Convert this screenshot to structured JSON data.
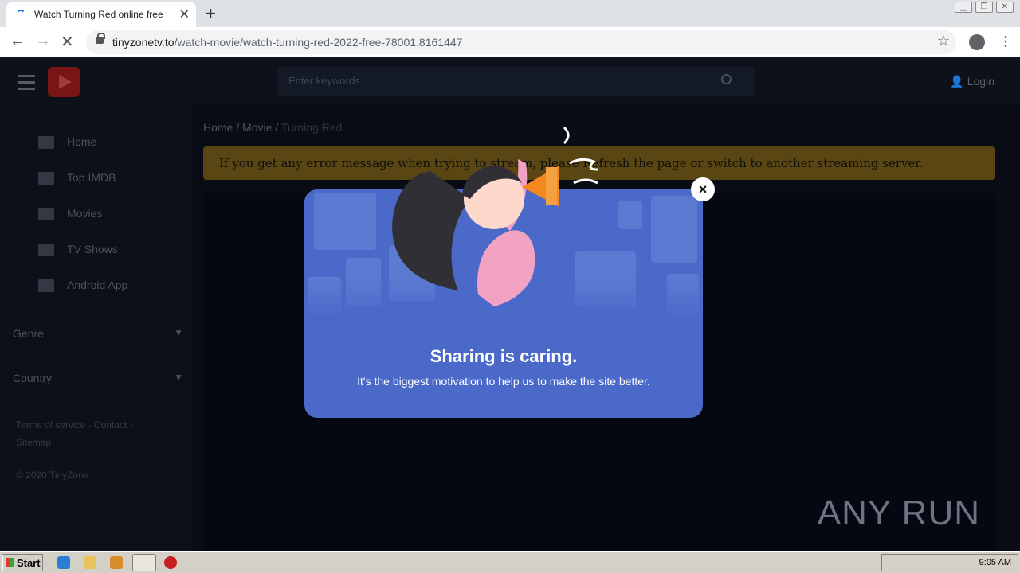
{
  "browser": {
    "tab_title": "Watch Turning Red online free",
    "url_host": "tinyzonetv.to",
    "url_path": "/watch-movie/watch-turning-red-2022-free-78001.8161447"
  },
  "site": {
    "search_placeholder": "Enter keywords...",
    "login_label": "Login",
    "nav": [
      {
        "label": "Home",
        "icon": "home-icon"
      },
      {
        "label": "Top IMDB",
        "icon": "rocket-icon"
      },
      {
        "label": "Movies",
        "icon": "film-icon"
      },
      {
        "label": "TV Shows",
        "icon": "tv-icon"
      },
      {
        "label": "Android App",
        "icon": "android-icon"
      }
    ],
    "categories": [
      {
        "label": "Genre"
      },
      {
        "label": "Country"
      }
    ],
    "footer": {
      "terms": "Terms of service",
      "contact": "Contact",
      "sitemap": "Sitemap",
      "copyright": "© 2020 TinyZone"
    },
    "breadcrumb": {
      "home": "Home",
      "movie": "Movie",
      "current": "Turning Red"
    },
    "notice": "If you get any error message when trying to stream, please Refresh the page or switch to another streaming server."
  },
  "modal": {
    "heading": "Sharing is caring.",
    "subtext": "It's the biggest motivation to help us to make the site better.",
    "close_label": "×"
  },
  "watermark": "ANY RUN",
  "taskbar": {
    "start_label": "Start",
    "clock": "9:05 AM"
  }
}
